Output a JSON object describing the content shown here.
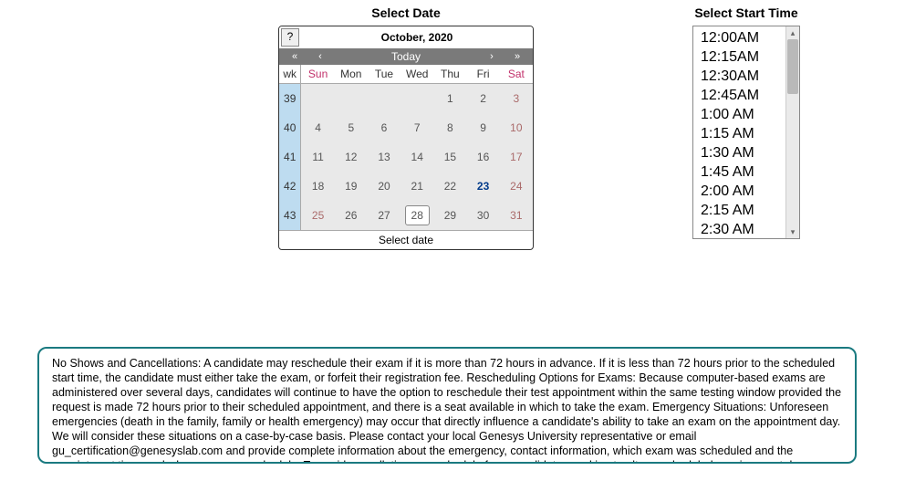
{
  "dateSection": {
    "title": "Select Date"
  },
  "timeSection": {
    "title": "Select Start Time"
  },
  "calendar": {
    "help": "?",
    "month_label": "October, 2020",
    "nav": {
      "prev_year": "«",
      "prev_month": "‹",
      "today_label": "Today",
      "next_month": "›",
      "next_year": "»"
    },
    "dow": {
      "wk": "wk",
      "sun": "Sun",
      "mon": "Mon",
      "tue": "Tue",
      "wed": "Wed",
      "thu": "Thu",
      "fri": "Fri",
      "sat": "Sat"
    },
    "weeks": [
      {
        "wk": "39",
        "d": [
          "",
          "",
          "",
          "",
          "1",
          "2",
          "3"
        ]
      },
      {
        "wk": "40",
        "d": [
          "4",
          "5",
          "6",
          "7",
          "8",
          "9",
          "10"
        ]
      },
      {
        "wk": "41",
        "d": [
          "11",
          "12",
          "13",
          "14",
          "15",
          "16",
          "17"
        ]
      },
      {
        "wk": "42",
        "d": [
          "18",
          "19",
          "20",
          "21",
          "22",
          "23",
          "24"
        ]
      },
      {
        "wk": "43",
        "d": [
          "25",
          "26",
          "27",
          "28",
          "29",
          "30",
          "31"
        ]
      }
    ],
    "today_value": "23",
    "selected_value": "28",
    "footer": "Select date"
  },
  "times": [
    "12:00AM",
    "12:15AM",
    "12:30AM",
    "12:45AM",
    "1:00 AM",
    "1:15 AM",
    "1:30 AM",
    "1:45 AM",
    "2:00 AM",
    "2:15 AM",
    "2:30 AM"
  ],
  "policy_text": "No Shows and Cancellations: A candidate may reschedule their exam if it is more than 72 hours in advance. If it is less than 72 hours prior to the scheduled start time, the candidate must either take the exam, or forfeit their registration fee. Rescheduling Options for Exams: Because computer-based exams are administered over several days, candidates will continue to have the option to reschedule their test appointment within the same testing window provided the request is made 72 hours prior to their scheduled appointment, and there is a seat available in which to take the exam. Emergency Situations: Unforeseen emergencies (death in the family, family or health emergency) may occur that directly influence a candidate's ability to take an exam on the appointment day. We will consider these situations on a case-by-case basis. Please contact your local Genesys University representative or email gu_certification@genesyslab.com and provide complete information about the emergency, contact information, which exam was scheduled and the appointment time, and when you can reschedule. To avoid cancellation or reschedule fees, candidates seeking to alter a scheduled session must do so a minimum of 3 business days in advance. Appointments cancelled or rescheduled within 3 business days will result in the assessment of one of the following fees: At Least 3 Business Day Cancellations or Reschedules"
}
